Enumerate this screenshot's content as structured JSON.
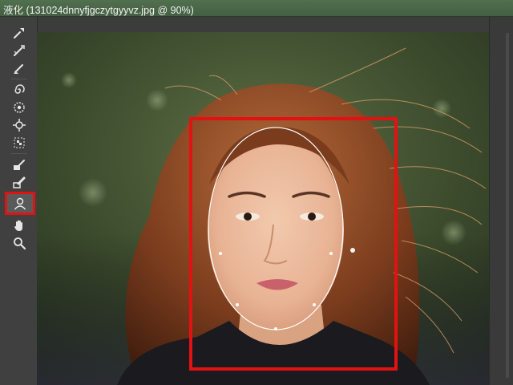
{
  "window": {
    "title": "液化 (131024dnnyfjgczytgyyvz.jpg @ 90%)"
  },
  "toolbar": {
    "tools": [
      {
        "name": "forward-warp-tool",
        "icon": "forward-warp-icon"
      },
      {
        "name": "reconstruct-tool",
        "icon": "reconstruct-icon"
      },
      {
        "name": "smooth-tool",
        "icon": "smooth-icon"
      },
      {
        "name": "twirl-clockwise-tool",
        "icon": "twirl-icon"
      },
      {
        "name": "pucker-tool",
        "icon": "pucker-icon"
      },
      {
        "name": "bloat-tool",
        "icon": "bloat-icon"
      },
      {
        "name": "push-left-tool",
        "icon": "push-left-icon"
      },
      {
        "name": "freeze-mask-tool",
        "icon": "freeze-mask-icon"
      },
      {
        "name": "thaw-mask-tool",
        "icon": "thaw-mask-icon"
      },
      {
        "name": "face-tool",
        "icon": "face-icon",
        "active": true
      },
      {
        "name": "hand-tool",
        "icon": "hand-icon"
      },
      {
        "name": "zoom-tool",
        "icon": "zoom-icon"
      }
    ]
  },
  "colors": {
    "title_bar": "#4a6848",
    "highlight": "#e31212",
    "face_outline": "#ffffff"
  }
}
